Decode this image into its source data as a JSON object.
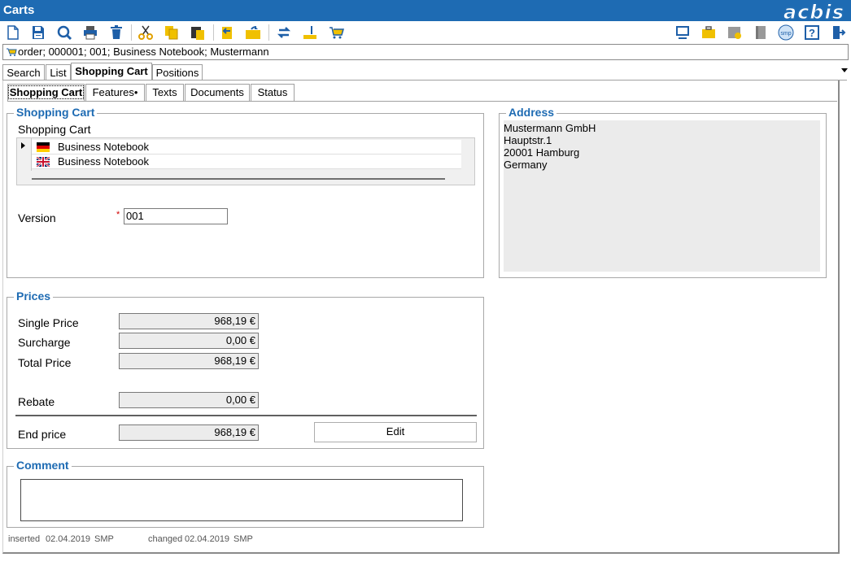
{
  "window": {
    "title": "Carts",
    "logo": "acbis"
  },
  "toolbar": {
    "left": [
      "new-icon",
      "save-icon",
      "search-icon",
      "print-icon",
      "delete-icon",
      "cut-icon",
      "copy-icon",
      "paste-icon",
      "export-icon",
      "open-folder-icon",
      "sync-icon",
      "measure-icon",
      "cart-icon"
    ],
    "right": [
      "monitor-icon",
      "briefcase-icon",
      "folder-check-icon",
      "book-icon",
      "smp-icon",
      "help-icon",
      "exit-icon"
    ],
    "smp_label": "smp",
    "help_label": "?"
  },
  "breadcrumb": {
    "text": "order; 000001; 001; Business Notebook; Mustermann"
  },
  "main_tabs": [
    "Search",
    "List",
    "Shopping Cart",
    "Positions"
  ],
  "sub_tabs": [
    "Shopping Cart",
    "Features•",
    "Texts",
    "Documents",
    "Status"
  ],
  "shopping_cart": {
    "legend": "Shopping Cart",
    "label": "Shopping Cart",
    "rows": [
      {
        "flag": "de",
        "text": "Business Notebook"
      },
      {
        "flag": "gb",
        "text": "Business Notebook"
      }
    ],
    "version_label": "Version",
    "required_mark": "*",
    "version_value": "001"
  },
  "address": {
    "legend": "Address",
    "lines": [
      "Mustermann GmbH",
      "Hauptstr.1",
      "20001 Hamburg",
      "Germany"
    ]
  },
  "prices": {
    "legend": "Prices",
    "single_label": "Single Price",
    "single_value": "968,19 €",
    "surcharge_label": "Surcharge",
    "surcharge_value": "0,00 €",
    "total_label": "Total Price",
    "total_value": "968,19 €",
    "rebate_label": "Rebate",
    "rebate_value": "0,00 €",
    "end_label": "End price",
    "end_value": "968,19 €",
    "edit_label": "Edit"
  },
  "comment": {
    "legend": "Comment",
    "value": ""
  },
  "footer": {
    "inserted_label": "inserted",
    "inserted_date": "02.04.2019",
    "inserted_user": "SMP",
    "changed_label": "changed",
    "changed_date": "02.04.2019",
    "changed_user": "SMP"
  },
  "colors": {
    "titlebar": "#1e6bb3",
    "legend": "#1e6bb3",
    "icon_yellow": "#f0c000",
    "icon_blue": "#1e5fa8"
  }
}
